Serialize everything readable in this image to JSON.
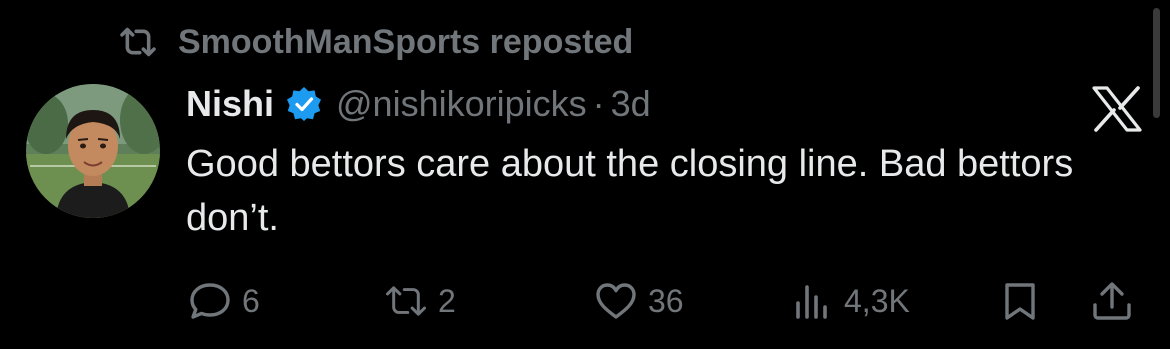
{
  "repost": {
    "icon": "repost-icon",
    "text": "SmoothManSports reposted"
  },
  "author": {
    "name": "Nishi",
    "handle": "@nishikoripicks",
    "separator": "·",
    "time": "3d",
    "verified": true,
    "avatar": "avatar-illustration"
  },
  "tweet": {
    "text": "Good bettors care about the closing line. Bad bettors don’t."
  },
  "actions": {
    "reply_count": "6",
    "repost_count": "2",
    "like_count": "36",
    "views_count": "4,3K"
  },
  "colors": {
    "background": "#000000",
    "primary_text": "#e7e9ea",
    "secondary_text": "#71767b",
    "verified_blue": "#1d9bf0"
  }
}
